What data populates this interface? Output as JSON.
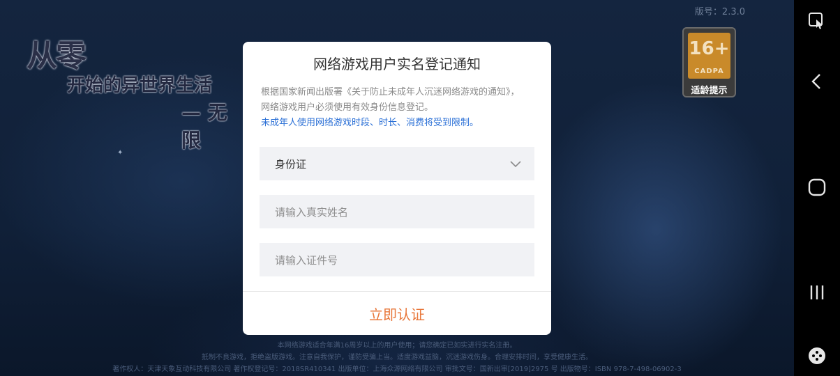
{
  "version_text": "版号：2.3.0",
  "logo": {
    "line1": "从零",
    "line2": "开始的异世界生活",
    "line3": "— 无限"
  },
  "age_rating": {
    "number": "16+",
    "org": "CADPA",
    "caption": "适龄提示",
    "color": "#c98a2a"
  },
  "dialog": {
    "title": "网络游戏用户实名登记通知",
    "description": "根据国家新闻出版署《关于防止未成年人沉迷网络游戏的通知》，网络游戏用户必须使用有效身份信息登记。",
    "warning": "未成年人使用网络游戏时段、时长、消费将受到限制。",
    "id_type_select": {
      "value": "身份证",
      "icon": "chevron-down-icon"
    },
    "name_input": {
      "placeholder": "请输入真实姓名",
      "value": ""
    },
    "id_number_input": {
      "placeholder": "请输入证件号",
      "value": ""
    },
    "confirm_label": "立即认证",
    "accent_color": "#e8773a",
    "warning_color": "#2a6fd6"
  },
  "footer": {
    "line1": "本网络游戏适合年满16周岁以上的用户使用；请您确定已如实进行实名注册。",
    "line2": "抵制不良游戏，拒绝盗版游戏。注意自我保护，谨防受骗上当。适度游戏益脑，沉迷游戏伤身。合理安排时间，享受健康生活。",
    "line3": "著作权人：天津天象互动科技有限公司   著作权登记号：2018SR410341   出版单位：上海众源网络有限公司   审批文号：国新出审[2019]2975 号   出版物号：ISBN 978-7-498-06902-3"
  },
  "nav": {
    "icons": [
      "screenshot-touch-icon",
      "back-icon",
      "home-icon",
      "recents-icon",
      "game-tools-icon"
    ]
  }
}
